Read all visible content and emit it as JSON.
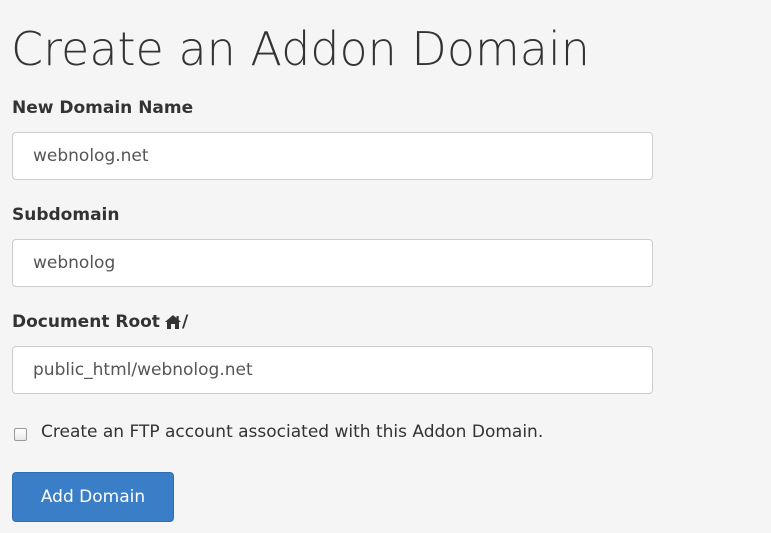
{
  "page": {
    "title": "Create an Addon Domain"
  },
  "form": {
    "new_domain": {
      "label": "New Domain Name",
      "value": "webnolog.net"
    },
    "subdomain": {
      "label": "Subdomain",
      "value": "webnolog"
    },
    "document_root": {
      "label": "Document Root",
      "path_separator": "/",
      "icon": "home-icon",
      "value": "public_html/webnolog.net"
    },
    "ftp_checkbox": {
      "label": "Create an FTP account associated with this Addon Domain.",
      "checked": false
    },
    "submit": {
      "label": "Add Domain"
    }
  },
  "colors": {
    "background": "#f5f5f5",
    "text": "#333333",
    "input_border": "#cccccc",
    "button_bg": "#3b7ec8",
    "button_text": "#ffffff"
  }
}
